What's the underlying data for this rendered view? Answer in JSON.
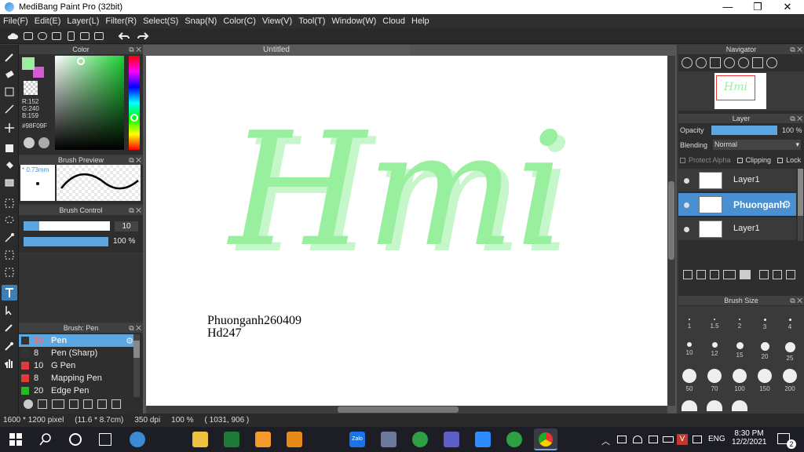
{
  "window": {
    "title": "MediBang Paint Pro (32bit)",
    "min": "—",
    "max": "❐",
    "close": "✕"
  },
  "menu": [
    "File(F)",
    "Edit(E)",
    "Layer(L)",
    "Filter(R)",
    "Select(S)",
    "Snap(N)",
    "Color(C)",
    "View(V)",
    "Tool(T)",
    "Window(W)",
    "Cloud",
    "Help"
  ],
  "color_panel": {
    "title": "Color",
    "r": "R:152",
    "g": "G:240",
    "b": "B:159",
    "hex": "#98F09F",
    "fg": "#98F09F",
    "bg": "#d35bd5"
  },
  "brush_preview": {
    "title": "Brush Preview",
    "size": "* 0.73mm"
  },
  "brush_control": {
    "title": "Brush Control",
    "size": "10",
    "opacity": "100 %"
  },
  "brush_list": {
    "title": "Brush: Pen",
    "items": [
      {
        "size": "10",
        "name": "Pen",
        "color": "#333333"
      },
      {
        "size": "8",
        "name": "Pen (Sharp)",
        "color": "#333333"
      },
      {
        "size": "10",
        "name": "G Pen",
        "color": "#e03a3a"
      },
      {
        "size": "8",
        "name": "Mapping Pen",
        "color": "#e03a3a"
      },
      {
        "size": "20",
        "name": "Edge Pen",
        "color": "#22bb22"
      }
    ]
  },
  "document": {
    "tab": "Untitled",
    "art_text": "Hmi",
    "caption_line1": "Phuonganh260409",
    "caption_line2": "Hd247"
  },
  "navigator": {
    "title": "Navigator"
  },
  "layer_panel": {
    "title": "Layer",
    "opacity_label": "Opacity",
    "opacity_value": "100 %",
    "blending_label": "Blending",
    "blending_value": "Normal",
    "protect_alpha": "Protect Alpha",
    "clipping": "Clipping",
    "lock": "Lock",
    "layers": [
      {
        "name": "Layer1",
        "selected": false
      },
      {
        "name": "Phuonganh",
        "selected": true
      },
      {
        "name": "Layer1",
        "selected": false
      }
    ]
  },
  "brush_size_panel": {
    "title": "Brush Size",
    "row1": [
      "1",
      "1.5",
      "2",
      "3",
      "4"
    ],
    "row2": [
      "10",
      "12",
      "15",
      "20",
      "25"
    ],
    "row3": [
      "50",
      "70",
      "100",
      "150",
      "200"
    ],
    "row4": [
      "",
      "",
      "",
      "",
      ""
    ]
  },
  "status": {
    "pixels": "1600 * 1200 pixel",
    "physical": "(11.6 * 8.7cm)",
    "dpi": "350 dpi",
    "zoom": "100 %",
    "coords": "( 1031, 906 )"
  },
  "taskbar": {
    "time": "8:30 PM",
    "date": "12/2/2021",
    "lang": "ENG",
    "notif": "2",
    "zalo": "Zalo"
  },
  "colors": {
    "accent": "#3f7fb8",
    "ink": "#98F09F",
    "ink_shadow": "#c6f7cb"
  }
}
